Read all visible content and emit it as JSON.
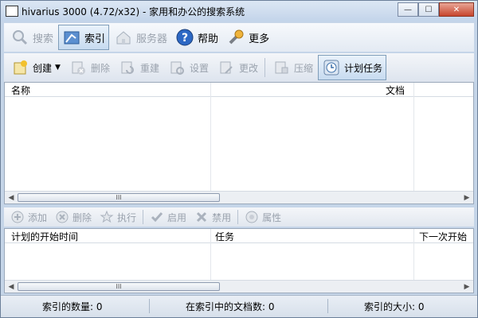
{
  "window": {
    "title": "hivarius 3000 (4.72/x32) - 家用和办公的搜索系统",
    "minimize": "—",
    "maximize": "☐",
    "close": "✕"
  },
  "main_toolbar": {
    "search": "搜索",
    "index": "索引",
    "server": "服务器",
    "help": "帮助",
    "more": "更多"
  },
  "index_toolbar": {
    "create": "创建",
    "delete": "删除",
    "rebuild": "重建",
    "settings": "设置",
    "modify": "更改",
    "compress": "压缩",
    "scheduled_tasks": "计划任务"
  },
  "index_table": {
    "columns": [
      "名称",
      "文档"
    ],
    "rows": []
  },
  "task_toolbar": {
    "add": "添加",
    "delete": "删除",
    "run": "执行",
    "enable": "启用",
    "disable": "禁用",
    "properties": "属性"
  },
  "task_table": {
    "columns": [
      "计划的开始时间",
      "任务",
      "下一次开始"
    ],
    "rows": []
  },
  "scrollbar": {
    "grip": "III"
  },
  "statusbar": {
    "index_count": "索引的数量: 0",
    "doc_count": "在索引中的文档数: 0",
    "index_size": "索引的大小: 0"
  },
  "colors": {
    "active_button": "#c7dbf0",
    "disabled_text": "#9aa2ad",
    "title_bar": "#c3d4ea"
  }
}
